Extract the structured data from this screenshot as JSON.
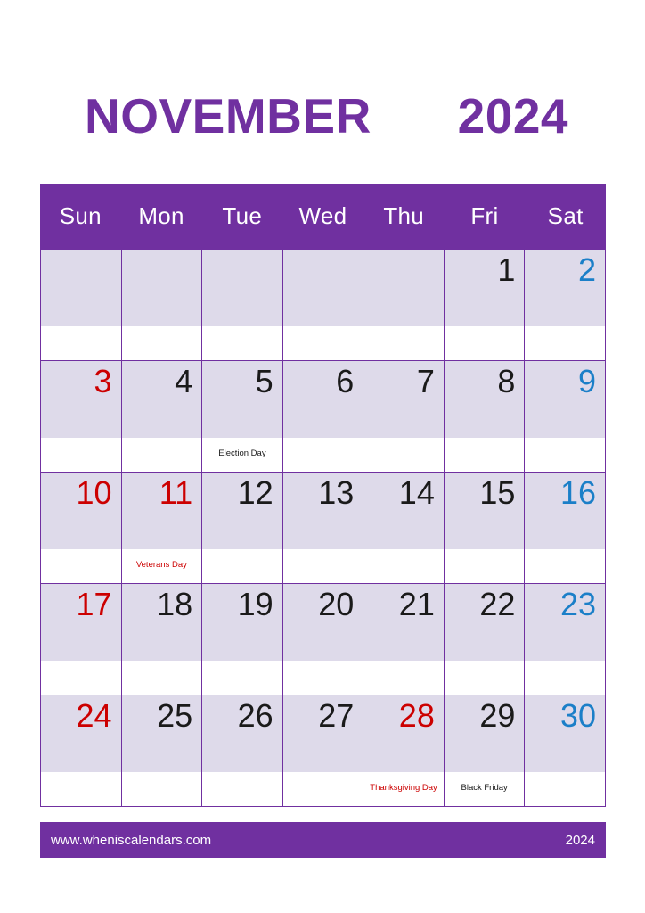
{
  "title": {
    "month": "NOVEMBER",
    "year": "2024",
    "color": "#7030A0"
  },
  "colors": {
    "header_purple": "#7030A0",
    "cell_shade": "#DEDAEA",
    "sunday_red": "#CC0000",
    "saturday_blue": "#1B7FC8",
    "weekday_black": "#1A1A1A",
    "page_background": "#FFFFFF"
  },
  "day_headers": [
    "Sun",
    "Mon",
    "Tue",
    "Wed",
    "Thu",
    "Fri",
    "Sat"
  ],
  "weeks": [
    [
      {
        "num": "",
        "event": "",
        "type": "empty"
      },
      {
        "num": "",
        "event": "",
        "type": "empty"
      },
      {
        "num": "",
        "event": "",
        "type": "empty"
      },
      {
        "num": "",
        "event": "",
        "type": "empty"
      },
      {
        "num": "",
        "event": "",
        "type": "empty"
      },
      {
        "num": "1",
        "event": "",
        "type": "weekday"
      },
      {
        "num": "2",
        "event": "",
        "type": "sat"
      }
    ],
    [
      {
        "num": "3",
        "event": "",
        "type": "sun"
      },
      {
        "num": "4",
        "event": "",
        "type": "weekday"
      },
      {
        "num": "5",
        "event": "Election Day",
        "type": "weekday",
        "event_color": "black"
      },
      {
        "num": "6",
        "event": "",
        "type": "weekday"
      },
      {
        "num": "7",
        "event": "",
        "type": "weekday"
      },
      {
        "num": "8",
        "event": "",
        "type": "weekday"
      },
      {
        "num": "9",
        "event": "",
        "type": "sat"
      }
    ],
    [
      {
        "num": "10",
        "event": "",
        "type": "sun"
      },
      {
        "num": "11",
        "event": "Veterans Day",
        "type": "holiday",
        "event_color": "red"
      },
      {
        "num": "12",
        "event": "",
        "type": "weekday"
      },
      {
        "num": "13",
        "event": "",
        "type": "weekday"
      },
      {
        "num": "14",
        "event": "",
        "type": "weekday"
      },
      {
        "num": "15",
        "event": "",
        "type": "weekday"
      },
      {
        "num": "16",
        "event": "",
        "type": "sat"
      }
    ],
    [
      {
        "num": "17",
        "event": "",
        "type": "sun"
      },
      {
        "num": "18",
        "event": "",
        "type": "weekday"
      },
      {
        "num": "19",
        "event": "",
        "type": "weekday"
      },
      {
        "num": "20",
        "event": "",
        "type": "weekday"
      },
      {
        "num": "21",
        "event": "",
        "type": "weekday"
      },
      {
        "num": "22",
        "event": "",
        "type": "weekday"
      },
      {
        "num": "23",
        "event": "",
        "type": "sat"
      }
    ],
    [
      {
        "num": "24",
        "event": "",
        "type": "sun"
      },
      {
        "num": "25",
        "event": "",
        "type": "weekday"
      },
      {
        "num": "26",
        "event": "",
        "type": "weekday"
      },
      {
        "num": "27",
        "event": "",
        "type": "weekday"
      },
      {
        "num": "28",
        "event": "Thanksgiving Day",
        "type": "holiday",
        "event_color": "red"
      },
      {
        "num": "29",
        "event": "Black Friday",
        "type": "weekday",
        "event_color": "black"
      },
      {
        "num": "30",
        "event": "",
        "type": "sat"
      }
    ]
  ],
  "footer": {
    "site": "www.wheniscalendars.com",
    "year": "2024"
  }
}
